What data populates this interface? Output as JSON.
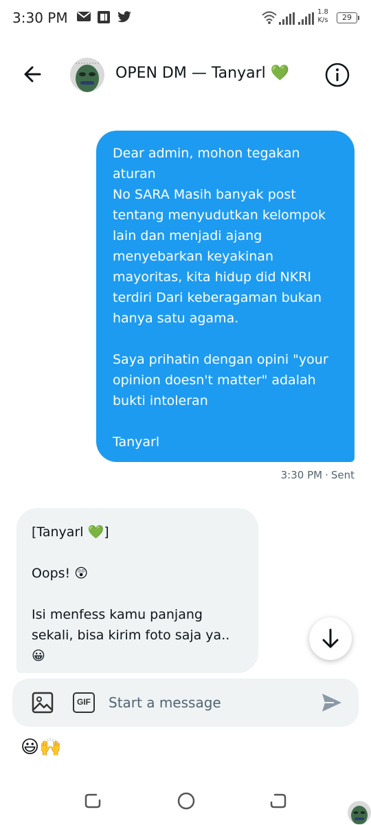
{
  "status_bar": {
    "time": "3:30 PM",
    "net_speed_value": "1.8",
    "net_speed_unit": "K/s",
    "battery": "29",
    "icons": [
      "mail-icon",
      "notes-icon",
      "twitter-icon",
      "wifi-icon",
      "signal-icon",
      "signal-icon"
    ]
  },
  "header": {
    "title": "OPEN DM — Tanyarl 💚",
    "back_icon": "arrow-left-icon",
    "info_icon": "info-icon"
  },
  "messages": {
    "outgoing": {
      "text": "Dear admin, mohon tegakan aturan\nNo SARA Masih banyak post tentang menyudutkan kelompok lain dan menjadi ajang menyebarkan keyakinan mayoritas, kita hidup did NKRI terdiri Dari keberagaman bukan hanya satu agama.\n\nSaya prihatin dengan opini \"your opinion doesn't matter\" adalah bukti intoleran\n\nTanyarl",
      "time": "3:30 PM",
      "separator": "·",
      "status": "Sent"
    },
    "incoming": {
      "text": "[Tanyarl 💚]\n\nOops! 😲\n\nIsi menfess kamu panjang sekali, bisa kirim foto saja ya.. 😀"
    }
  },
  "composer": {
    "placeholder": "Start a message",
    "gif_label": "GIF"
  },
  "quick_emojis": "😃🙌",
  "colors": {
    "accent": "#1d9bf0",
    "incoming_bubble": "#eff3f4",
    "meta_text": "#536471"
  }
}
